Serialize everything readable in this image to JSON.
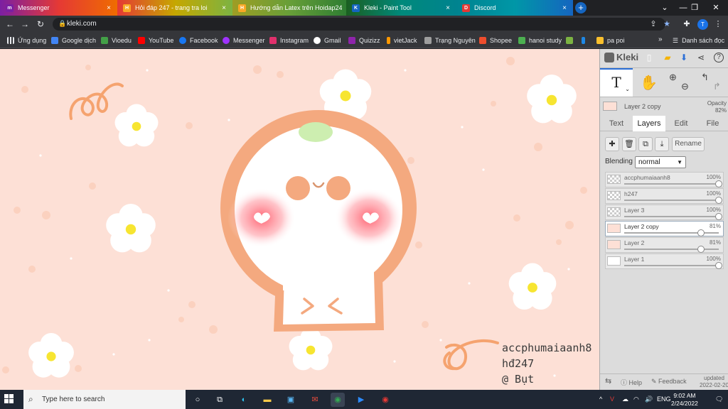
{
  "tabs": [
    {
      "title": "Messenger",
      "icon": "messenger-icon",
      "color": "#7b1fa2"
    },
    {
      "title": "Hỏi đáp 247 - trang tra loi",
      "icon": "hoidap-icon",
      "color": "#f9a825"
    },
    {
      "title": "Hướng dẫn Latex trên Hoidap24",
      "icon": "hoidap-icon",
      "color": "#f9a825"
    },
    {
      "title": "Kleki - Paint Tool",
      "icon": "kleki-icon",
      "color": "#1565c0"
    },
    {
      "title": "Discord",
      "icon": "discord-icon",
      "color": "#e53935"
    }
  ],
  "address": {
    "url": "kleki.com",
    "avatar_initial": "T"
  },
  "bookmarks": [
    {
      "label": "Ứng dụng",
      "color": "#e8eaed"
    },
    {
      "label": "Google dịch",
      "color": "#4285f4"
    },
    {
      "label": "Vioedu",
      "color": "#43a047"
    },
    {
      "label": "YouTube",
      "color": "#ff0000"
    },
    {
      "label": "Facebook",
      "color": "#1877f2"
    },
    {
      "label": "Messenger",
      "color": "#a033ff"
    },
    {
      "label": "Instagram",
      "color": "#e1306c"
    },
    {
      "label": "Gmail",
      "color": "#ffffff"
    },
    {
      "label": "Quizizz",
      "color": "#8e24aa"
    },
    {
      "label": "vietJack",
      "color": "#ff9800"
    },
    {
      "label": "Trạng Nguyên",
      "color": "#9e9e9e"
    },
    {
      "label": "Shopee",
      "color": "#ee4d2d"
    },
    {
      "label": "hanoi study",
      "color": "#4caf50"
    },
    {
      "label": "",
      "color": "#7cb342"
    },
    {
      "label": "",
      "color": "#1e88e5"
    },
    {
      "label": "pa poi",
      "color": "#fbc02d"
    }
  ],
  "bookmarks_overflow": "»",
  "reading_list": "Danh sách đọc",
  "canvas": {
    "background": "#fde0d6",
    "signature": [
      "accphumaiaanh8",
      "hđ247",
      "@ Bụt"
    ]
  },
  "kleki": {
    "logo": "Kleki",
    "active_layer": {
      "name": "Layer 2 copy",
      "opacity_label": "Opacity",
      "opacity_value": "82%"
    },
    "tabs": [
      "Text",
      "Layers",
      "Edit",
      "File"
    ],
    "active_tab": "Layers",
    "rename_label": "Rename",
    "blending_label": "Blending",
    "blending_value": "normal",
    "layers": [
      {
        "name": "accphumaiaanh8",
        "opacity": "100%",
        "level": 1.0
      },
      {
        "name": "h247",
        "opacity": "100%",
        "level": 1.0
      },
      {
        "name": "Layer 3",
        "opacity": "100%",
        "level": 1.0
      },
      {
        "name": "Layer 2 copy",
        "opacity": "81%",
        "level": 0.81,
        "selected": true
      },
      {
        "name": "Layer 2",
        "opacity": "81%",
        "level": 0.81
      },
      {
        "name": "Layer 1",
        "opacity": "100%",
        "level": 1.0
      }
    ],
    "footer": {
      "help": "Help",
      "feedback": "Feedback",
      "updated": "updated",
      "date": "2022-02-20"
    }
  },
  "taskbar": {
    "search_placeholder": "Type here to search",
    "lang": "ENG",
    "time": "9:02 AM",
    "date": "2/24/2022"
  }
}
